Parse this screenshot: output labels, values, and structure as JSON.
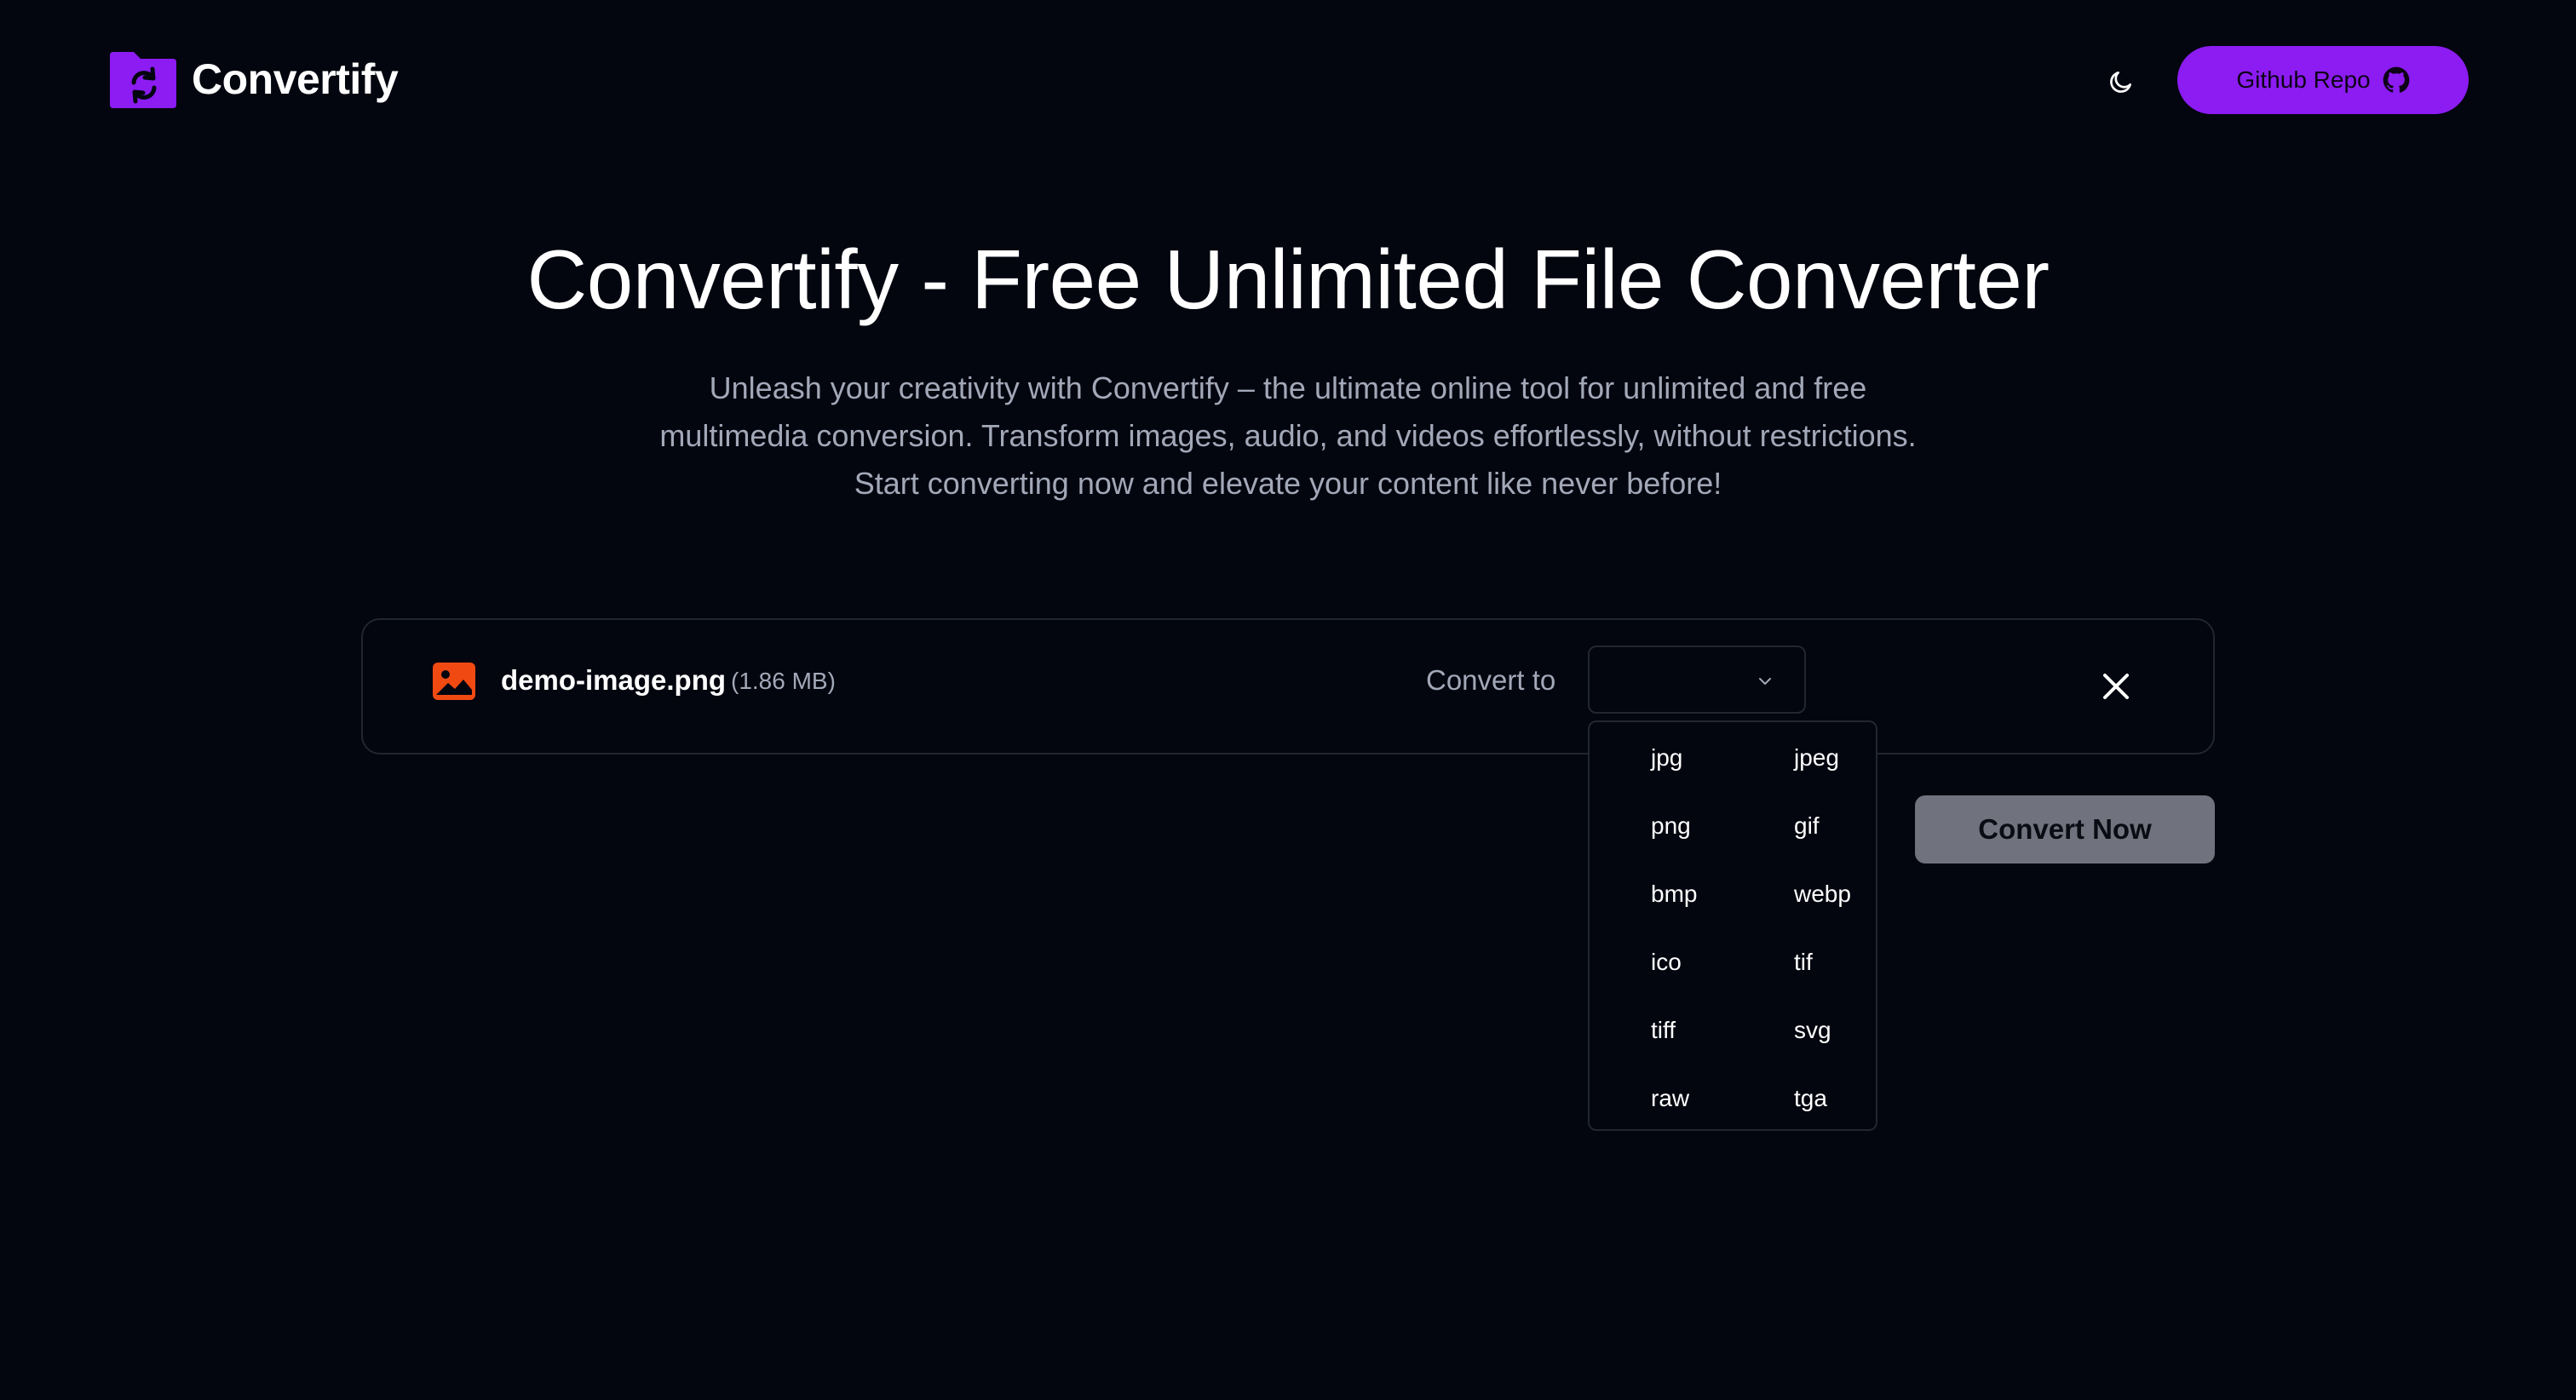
{
  "header": {
    "brand": "Convertify",
    "logo_icon": "folder-convert-icon",
    "theme_icon": "moon-icon",
    "github_label": "Github Repo",
    "github_icon": "github-icon"
  },
  "hero": {
    "title": "Convertify - Free Unlimited File Converter",
    "subtitle": "Unleash your creativity with Convertify – the ultimate online tool for unlimited and free multimedia conversion. Transform images, audio, and videos effortlessly, without restrictions. Start converting now and elevate your content like never before!"
  },
  "file": {
    "icon": "image-file-icon",
    "name": "demo-image.png",
    "size": "(1.86 MB)",
    "convert_label": "Convert to",
    "selected_value": "",
    "close_icon": "close-icon"
  },
  "dropdown": {
    "options": [
      "jpg",
      "jpeg",
      "png",
      "gif",
      "bmp",
      "webp",
      "ico",
      "tif",
      "tiff",
      "svg",
      "raw",
      "tga"
    ]
  },
  "actions": {
    "convert_label": "Convert Now"
  },
  "colors": {
    "background": "#03050f",
    "accent": "#8c1cf2",
    "file_icon": "#f04a12",
    "muted_text": "#a3a8b8",
    "border": "#22262f",
    "disabled_button": "#70737d"
  }
}
